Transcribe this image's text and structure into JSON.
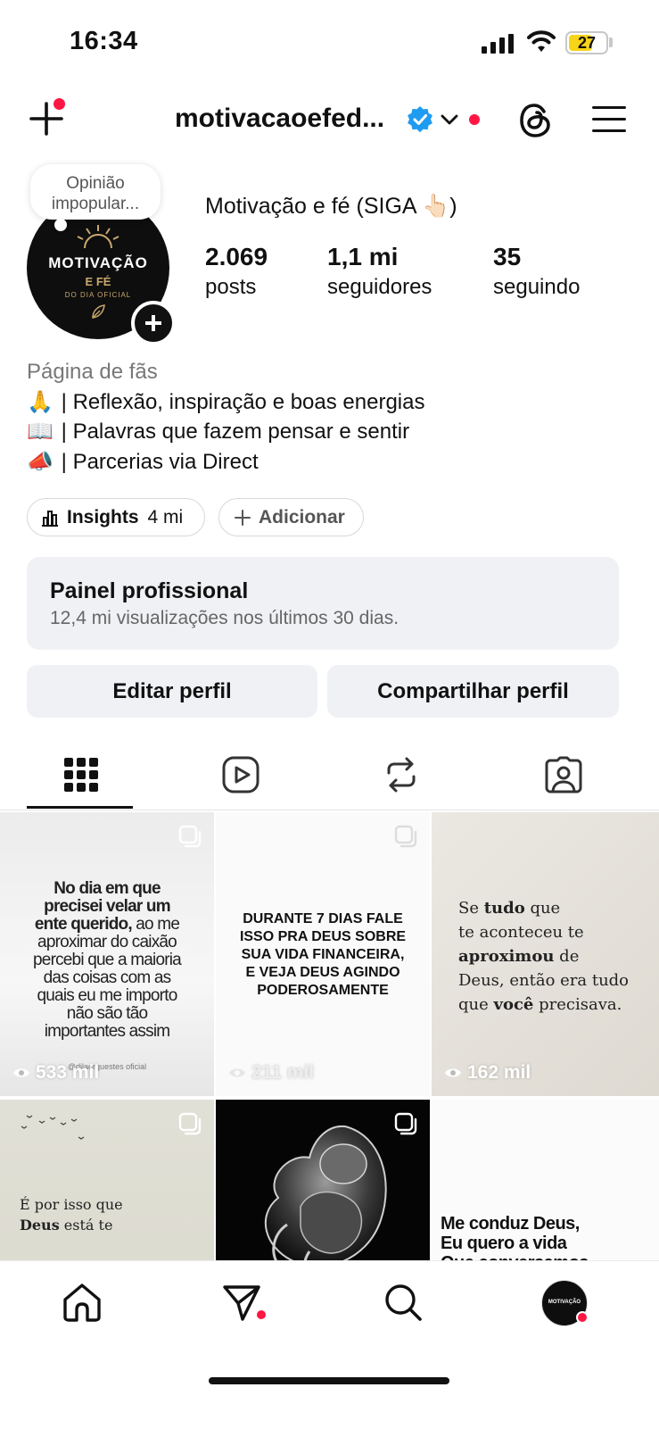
{
  "status_bar": {
    "time": "16:34",
    "battery": "27"
  },
  "header": {
    "username": "motivacaoefed..."
  },
  "note": {
    "text": "Opinião impopular..."
  },
  "avatar": {
    "line1": "MOTIVAÇÃO",
    "line2": "E FÉ",
    "line3": "DO DIA OFICIAL"
  },
  "profile": {
    "display_name": "Motivação e fé (SIGA 👆🏻)",
    "stats": [
      {
        "value": "2.069",
        "label": "posts"
      },
      {
        "value": "1,1 mi",
        "label": "seguidores"
      },
      {
        "value": "35",
        "label": "seguindo"
      }
    ],
    "category": "Página de fãs",
    "bio": [
      {
        "emoji": "🙏",
        "text": "| Reflexão, inspiração e boas energias"
      },
      {
        "emoji": "📖",
        "text": "| Palavras que fazem pensar e sentir"
      },
      {
        "emoji": "📣",
        "text": "| Parcerias via Direct"
      }
    ]
  },
  "chips": {
    "insights_label": "Insights",
    "insights_value": "4 mi",
    "add_label": "Adicionar"
  },
  "pro_panel": {
    "title": "Painel profissional",
    "subtitle": "12,4 mi visualizações nos últimos 30 dias."
  },
  "buttons": {
    "edit": "Editar perfil",
    "share": "Compartilhar perfil"
  },
  "tabs": [
    "grid-icon",
    "reels-icon",
    "reposts-icon",
    "tagged-icon"
  ],
  "grid": [
    {
      "views": "533 mil",
      "bold_lines": [
        "No dia em que",
        "precisei velar um"
      ],
      "mixed_bold": "ente querido,",
      "mixed_rest": " ao me",
      "lines": [
        "aproximar do caixão",
        "percebi que a maioria",
        "das coisas com as",
        "quais eu me importo",
        "não são tão",
        "importantes assim"
      ],
      "handle": "@dilaorquestes oficial"
    },
    {
      "views": "211 mil",
      "lines": [
        "DURANTE 7 DIAS FALE",
        "ISSO PRA DEUS SOBRE",
        "SUA VIDA FINANCEIRA,",
        "E VEJA DEUS AGINDO",
        "PODEROSAMENTE"
      ]
    },
    {
      "views": "162 mil",
      "l1a": "Se ",
      "l1b": "tudo",
      "l1c": " que",
      "l2": "te aconteceu te",
      "l3a": "aproximou",
      "l3b": " de",
      "l4": "Deus, então era tudo",
      "l5a": "que ",
      "l5b": "você",
      "l5c": " precisava."
    },
    {
      "l1": "É por isso que",
      "l2a": "Deus",
      "l2b": " está te"
    },
    {},
    {
      "lines": [
        "Me conduz Deus,",
        "Eu quero a vida",
        "Que conversamos"
      ]
    }
  ],
  "colors": {
    "accent_red": "#ff1744",
    "verified_blue": "#1f9cf0",
    "panel_bg": "#eff1f4"
  }
}
